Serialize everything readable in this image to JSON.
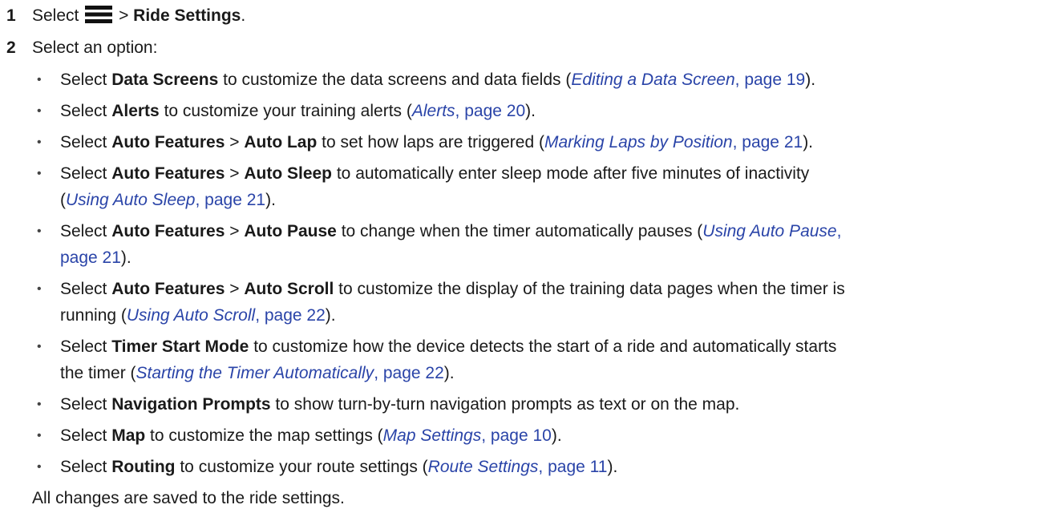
{
  "steps": [
    {
      "number": "1",
      "prefix": "Select",
      "icon": "menu-icon",
      "separator": ">",
      "target": "Ride Settings",
      "suffix": "."
    },
    {
      "number": "2",
      "text": "Select an option:"
    }
  ],
  "options": [
    {
      "lead": "Select ",
      "bold1": "Data Screens",
      "mid": "",
      "bold2": "",
      "text": " to customize the data screens and data fields (",
      "text2": "",
      "ref_title": "Editing a Data Screen",
      "ref_page": ", page 19",
      "close": ")."
    },
    {
      "lead": "Select ",
      "bold1": "Alerts",
      "mid": "",
      "bold2": "",
      "text": " to customize your training alerts (",
      "text2": "",
      "ref_title": "Alerts",
      "ref_page": ", page 20",
      "close": ")."
    },
    {
      "lead": "Select ",
      "bold1": "Auto Features",
      "mid": " > ",
      "bold2": "Auto Lap",
      "text": " to set how laps are triggered (",
      "text2": "",
      "ref_title": "Marking Laps by Position",
      "ref_page": ", page 21",
      "close": ")."
    },
    {
      "lead": "Select ",
      "bold1": "Auto Features",
      "mid": " > ",
      "bold2": "Auto Sleep",
      "text": " to automatically enter sleep mode after five minutes of inactivity",
      "text2": "(",
      "ref_title": "Using Auto Sleep",
      "ref_page": ", page 21",
      "close": ")."
    },
    {
      "lead": "Select ",
      "bold1": "Auto Features",
      "mid": " > ",
      "bold2": "Auto Pause",
      "text": " to change when the timer automatically pauses (",
      "text2": "",
      "ref_title": "Using Auto Pause",
      "ref_page": ",",
      "ref_page2": "page 21",
      "close": ")."
    },
    {
      "lead": "Select ",
      "bold1": "Auto Features",
      "mid": " > ",
      "bold2": "Auto Scroll",
      "text": " to customize the display of the training data pages when the timer is",
      "text2": "running (",
      "ref_title": "Using Auto Scroll",
      "ref_page": ", page 22",
      "close": ")."
    },
    {
      "lead": "Select ",
      "bold1": "Timer Start Mode",
      "mid": "",
      "bold2": "",
      "text": " to customize how the device detects the start of a ride and automatically starts",
      "text2": "the timer (",
      "ref_title": "Starting the Timer Automatically",
      "ref_page": ", page 22",
      "close": ")."
    },
    {
      "lead": "Select ",
      "bold1": "Navigation Prompts",
      "mid": "",
      "bold2": "",
      "text": " to show turn-by-turn navigation prompts as text or on the map.",
      "text2": "",
      "ref_title": "",
      "ref_page": "",
      "close": ""
    },
    {
      "lead": "Select ",
      "bold1": "Map",
      "mid": "",
      "bold2": "",
      "text": " to customize the map settings (",
      "text2": "",
      "ref_title": "Map Settings",
      "ref_page": ", page 10",
      "close": ")."
    },
    {
      "lead": "Select ",
      "bold1": "Routing",
      "mid": "",
      "bold2": "",
      "text": " to customize your route settings (",
      "text2": "",
      "ref_title": "Route Settings",
      "ref_page": ", page 11",
      "close": ")."
    }
  ],
  "bullet_glyph": "•",
  "footer": "All changes are saved to the ride settings.",
  "colors": {
    "text": "#1a1a1a",
    "link": "#2a44a8"
  }
}
